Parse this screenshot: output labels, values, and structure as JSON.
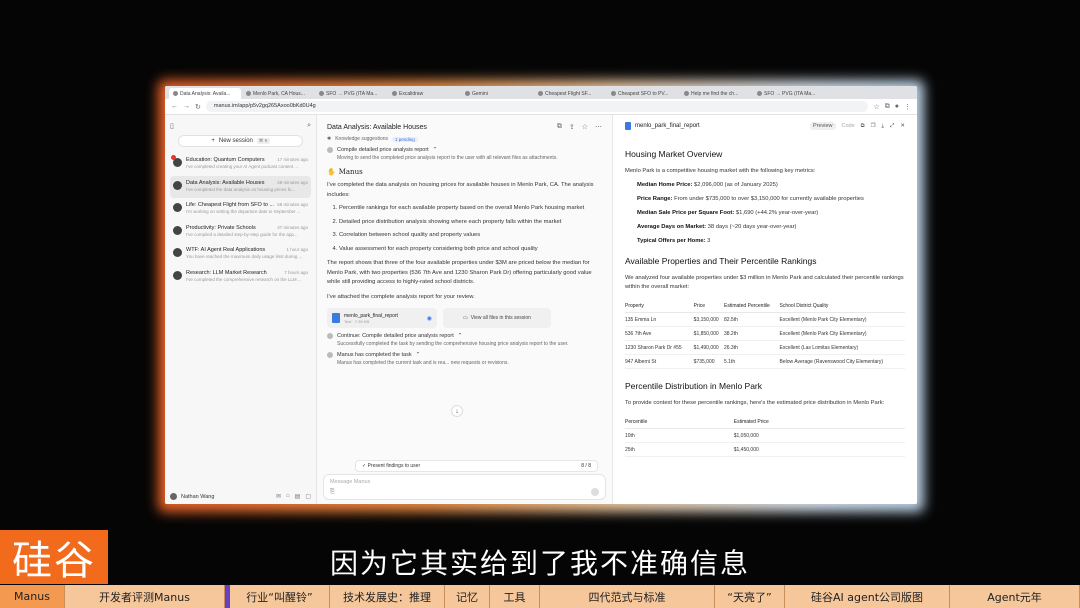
{
  "colors": {
    "brand_orange": "#f26a1b",
    "chapter_bar": "#f6c79a",
    "active_chapter": "#f39a50",
    "marker_purple": "#6a3fc4",
    "link_blue": "#3b7be0"
  },
  "browser": {
    "tabs": [
      "Data Analysis: Availa...",
      "Menlo Park, CA Hous...",
      "SFO → PVG (ITA Ma...",
      "Excalidraw",
      "Gemini",
      "Cheapest Flight SF...",
      "Cheapest SFO to PV...",
      "Help me find the ch...",
      "SFO → PVG (ITA Ma..."
    ],
    "url": "manus.im/app/p5v2gq265Axoo0bKd0U4g"
  },
  "sidebar": {
    "new_session": "New session",
    "new_session_kbd": "⌘ K",
    "sessions": [
      {
        "title": "Education: Quantum Computers",
        "time": "17 minutes ago",
        "sub": "I've completed creating your AI Agent podcast content ..."
      },
      {
        "title": "Data Analysis: Available Houses",
        "time": "28 minutes ago",
        "sub": "I've completed the data analysis on housing prices fo..."
      },
      {
        "title": "Life: Cheapest Flight from SFO to ...",
        "time": "58 minutes ago",
        "sub": "I'm working on setting the departure date to September ..."
      },
      {
        "title": "Productivity: Private Schools",
        "time": "47 minutes ago",
        "sub": "I've compiled a detailed step-by-step guide for the app..."
      },
      {
        "title": "WTF: AI Agent Real Applications",
        "time": "1 hour ago",
        "sub": "You have reached the maximum daily usage limit during ..."
      },
      {
        "title": "Research: LLM Market Research",
        "time": "7 hours ago",
        "sub": "I've completed the comprehensive research on the LLM ..."
      }
    ],
    "user": "Nathan Wang"
  },
  "chat": {
    "title": "Data Analysis: Available Houses",
    "knowledge": "Knowledge suggestions",
    "pending": "1 pending",
    "step1": "Compile detailed price analysis report",
    "step1_sub": "Moving to send the completed price analysis report to the user with all relevant files as attachments.",
    "manus": "Manus",
    "intro": "I've completed the data analysis on housing prices for available houses in Menlo Park, CA. The analysis includes:",
    "items": [
      "Percentile rankings for each available property based on the overall Menlo Park housing market",
      "Detailed price distribution analysis showing where each property falls within the market",
      "Correlation between school quality and property values",
      "Value assessment for each property considering both price and school quality"
    ],
    "report_text": "The report shows that three of the four available properties under $3M are priced below the median for Menlo Park, with two properties (536 7th Ave and 1230 Sharon Park Dr) offering particularly good value while still providing access to highly-rated school districts.",
    "attached": "I've attached the complete analysis report for your review.",
    "file_name": "menlo_park_final_report",
    "file_meta": "Text · 7.39 KB",
    "view_all": "View all files in this session",
    "step2": "Continue: Compile detailed price analysis report",
    "step2_sub": "Successfully completed the task by sending the comprehensive housing price analysis report to the user.",
    "step3": "Manus has completed the task",
    "step3_sub": "Manus has completed the current task and is rea... new requests or revisions.",
    "findings": "Present findings to user",
    "findings_count": "8 / 8",
    "placeholder": "Message Manus"
  },
  "report": {
    "file": "menlo_park_final_report",
    "preview": "Preview",
    "code": "Code",
    "h_overview": "Housing Market Overview",
    "overview_intro": "Menlo Park is a competitive housing market with the following key metrics:",
    "metrics": [
      {
        "k": "Median Home Price:",
        "v": "$2,096,000 (as of January 2025)"
      },
      {
        "k": "Price Range:",
        "v": "From under $735,000 to over $3,150,000 for currently available properties"
      },
      {
        "k": "Median Sale Price per Square Foot:",
        "v": "$1,690 (+44.2% year-over-year)"
      },
      {
        "k": "Average Days on Market:",
        "v": "38 days (~20 days year-over-year)"
      },
      {
        "k": "Typical Offers per Home:",
        "v": "3"
      }
    ],
    "h_avail": "Available Properties and Their Percentile Rankings",
    "avail_intro": "We analyzed four available properties under $3 million in Menlo Park and calculated their percentile rankings within the overall market:",
    "table_headers": [
      "Property",
      "Price",
      "Estimated Percentile",
      "School District Quality"
    ],
    "table_rows": [
      [
        "135 Emma Ln",
        "$3,150,000",
        "82.5th",
        "Excellent (Menlo Park City Elementary)"
      ],
      [
        "536 7th Ave",
        "$1,850,000",
        "38.2th",
        "Excellent (Menlo Park City Elementary)"
      ],
      [
        "1230 Sharon Park Dr #55",
        "$1,490,000",
        "26.3th",
        "Excellent (Las Lomitas Elementary)"
      ],
      [
        "947 Alberni St",
        "$735,000",
        "5.1th",
        "Below Average (Ravenswood City Elementary)"
      ]
    ],
    "h_dist": "Percentile Distribution in Menlo Park",
    "dist_intro": "To provide context for these percentile rankings, here's the estimated price distribution in Menlo Park:",
    "dist_headers": [
      "Percentile",
      "Estimated Price"
    ],
    "dist_rows": [
      [
        "10th",
        "$1,050,000"
      ],
      [
        "25th",
        "$1,450,000"
      ]
    ]
  },
  "overlay": {
    "logo": "硅谷",
    "subtitle": "因为它其实给到了我不准确信息",
    "chapters": [
      "Manus",
      "开发者评测Manus",
      "",
      "行业“叫醒铃”",
      "技术发展史：推理",
      "记忆",
      "工具",
      "四代范式与标准",
      "“天亮了”",
      "硅谷AI agent公司版图",
      "Agent元年"
    ]
  }
}
